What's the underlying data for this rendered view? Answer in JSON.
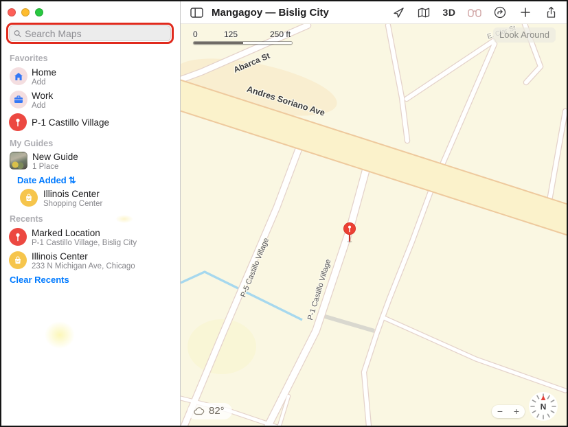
{
  "window": {
    "title": "Mangagoy — Bislig City"
  },
  "colors": {
    "accent_blue": "#007aff",
    "annotation_red": "#e02a1d",
    "pin_red": "#ec4841",
    "guide_yellow": "#f6c54c",
    "map_background": "#faf7e2",
    "avenue_yellow": "#fbf2cb",
    "water_blue": "#a6d8ee",
    "traffic_red": "#fe5f57",
    "traffic_yellow": "#febc2e",
    "traffic_green": "#28c840"
  },
  "sidebar": {
    "search": {
      "placeholder": "Search Maps",
      "icon": "search-icon"
    },
    "headers": {
      "favorites": "Favorites",
      "my_guides": "My Guides",
      "recents": "Recents"
    },
    "favorites": [
      {
        "title": "Home",
        "subtitle": "Add",
        "icon": "home-icon"
      },
      {
        "title": "Work",
        "subtitle": "Add",
        "icon": "briefcase-icon"
      },
      {
        "title": "P-1 Castillo Village",
        "subtitle": "",
        "icon": "pin-icon"
      }
    ],
    "guides": {
      "new_guide": {
        "title": "New Guide",
        "subtitle": "1 Place",
        "icon": "guide-photo-thumbnail"
      },
      "sort": {
        "label": "Date Added",
        "glyph": "⇅"
      },
      "items": [
        {
          "title": "Illinois Center",
          "subtitle": "Shopping Center",
          "icon": "shopping-bag-icon"
        }
      ]
    },
    "recents": {
      "items": [
        {
          "title": "Marked Location",
          "subtitle": "P-1 Castillo Village, Bislig City",
          "icon": "pin-icon"
        },
        {
          "title": "Illinois Center",
          "subtitle": "233 N Michigan Ave, Chicago",
          "icon": "shopping-bag-icon"
        }
      ],
      "clear_label": "Clear Recents"
    }
  },
  "toolbar": {
    "labels": {
      "three_d": "3D"
    },
    "icons": [
      "sidebar-toggle-icon",
      "location-arrow-icon",
      "map-icon",
      "3d-button",
      "binoculars-icon",
      "directions-icon",
      "add-icon",
      "share-icon"
    ]
  },
  "map": {
    "scale": {
      "start": "0",
      "mid": "125",
      "end": "250 ft"
    },
    "labels": {
      "abarca": "Abarca St",
      "andres_soriano": "Andres Soriano Ave",
      "p5_castillo": "P-5 Castillo Village",
      "p1_castillo": "P-1 Castillo Village",
      "e_clar": "E. Clar St"
    },
    "tooltip": "Look Around",
    "weather": "82°",
    "compass_north": "N",
    "zoom_out": "−",
    "zoom_in": "+"
  }
}
